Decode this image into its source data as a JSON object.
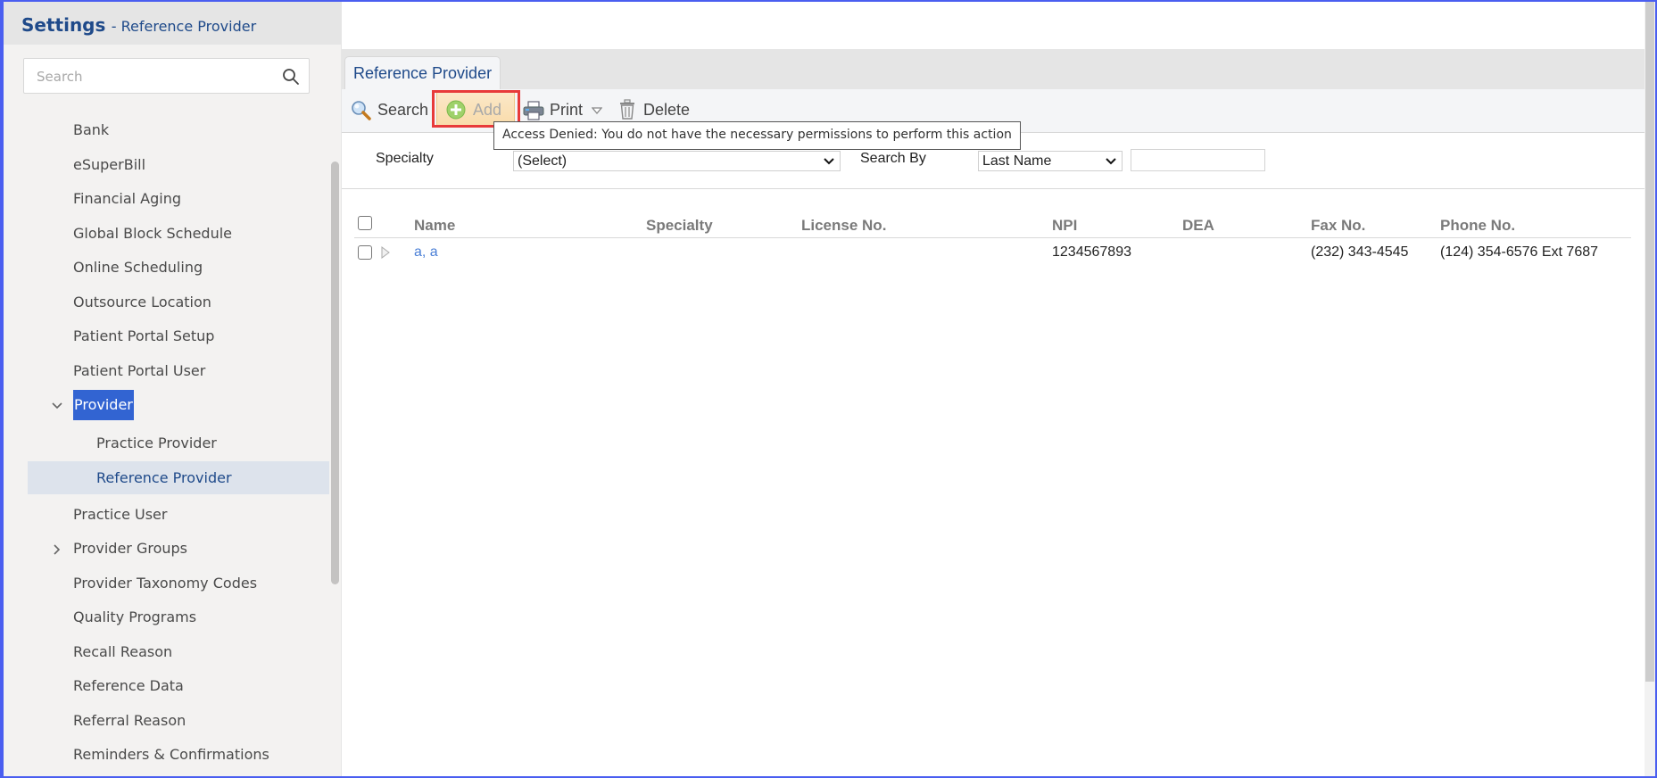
{
  "sidebar": {
    "title": "Settings",
    "subtitle": "- Reference Provider",
    "search_placeholder": "Search",
    "items": [
      {
        "label": "Bank"
      },
      {
        "label": "eSuperBill"
      },
      {
        "label": "Financial Aging"
      },
      {
        "label": "Global Block Schedule"
      },
      {
        "label": "Online Scheduling"
      },
      {
        "label": "Outsource Location"
      },
      {
        "label": "Patient Portal Setup"
      },
      {
        "label": "Patient Portal User"
      },
      {
        "label": "Provider",
        "expanded": true,
        "highlighted": true
      },
      {
        "label": "Practice Provider",
        "child": true
      },
      {
        "label": "Reference Provider",
        "child": true,
        "active": true
      },
      {
        "label": "Practice User"
      },
      {
        "label": "Provider Groups",
        "collapsed": true
      },
      {
        "label": "Provider Taxonomy Codes"
      },
      {
        "label": "Quality Programs"
      },
      {
        "label": "Recall Reason"
      },
      {
        "label": "Reference Data"
      },
      {
        "label": "Referral Reason"
      },
      {
        "label": "Reminders & Confirmations"
      }
    ]
  },
  "main": {
    "tab_label": "Reference Provider",
    "toolbar": {
      "search": "Search",
      "add": "Add",
      "print": "Print",
      "delete": "Delete"
    },
    "tooltip": "Access Denied: You do not have the necessary permissions to perform this action",
    "filters": {
      "specialty_label": "Specialty",
      "specialty_value": "(Select)",
      "search_by_label": "Search By",
      "search_by_value": "Last Name",
      "search_text": ""
    },
    "grid": {
      "columns": [
        "Name",
        "Specialty",
        "License No.",
        "NPI",
        "DEA",
        "Fax No.",
        "Phone No."
      ],
      "rows": [
        {
          "name": "a, a",
          "specialty": "",
          "license": "",
          "npi": "1234567893",
          "dea": "",
          "fax": "(232) 343-4545",
          "phone": "(124) 354-6576 Ext 7687"
        }
      ]
    }
  },
  "colors": {
    "brand_blue": "#1f4a8a",
    "selection_blue": "#3264d2",
    "active_row": "#dde3ec",
    "highlight_red": "#e83a3a",
    "link_blue": "#4a7fd6"
  }
}
